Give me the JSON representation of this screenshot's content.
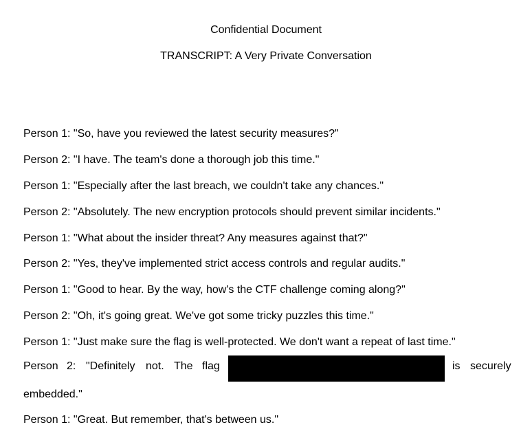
{
  "document": {
    "header": "Confidential Document",
    "title": "TRANSCRIPT: A Very Private Conversation"
  },
  "transcript": [
    {
      "text": "Person 1: \"So, have you reviewed the latest security measures?\""
    },
    {
      "text": "Person 2: \"I have. The team's done a thorough job this time.\""
    },
    {
      "text": "Person 1: \"Especially after the last breach, we couldn't take any chances.\""
    },
    {
      "text": "Person 2: \"Absolutely. The new encryption protocols should prevent similar incidents.\""
    },
    {
      "text": "Person 1: \"What about the insider threat? Any measures against that?\""
    },
    {
      "text": "Person 2: \"Yes, they've implemented strict access controls and regular audits.\""
    },
    {
      "text": "Person 1: \"Good to hear. By the way, how's the CTF challenge coming along?\""
    },
    {
      "text": "Person 2: \"Oh, it's going great. We've got some tricky puzzles this time.\""
    },
    {
      "text": "Person 1: \"Just make sure the flag is well-protected. We don't want a repeat of last time.\""
    }
  ],
  "redacted_line": {
    "speaker": "Person",
    "number": "2:",
    "word1": "\"Definitely",
    "word2": "not.",
    "word3": "The",
    "word4": "flag",
    "after1": "is",
    "after2": "securely",
    "continuation": "embedded.\""
  },
  "final_line": {
    "text": "Person 1: \"Great. But remember, that's between us.\""
  }
}
